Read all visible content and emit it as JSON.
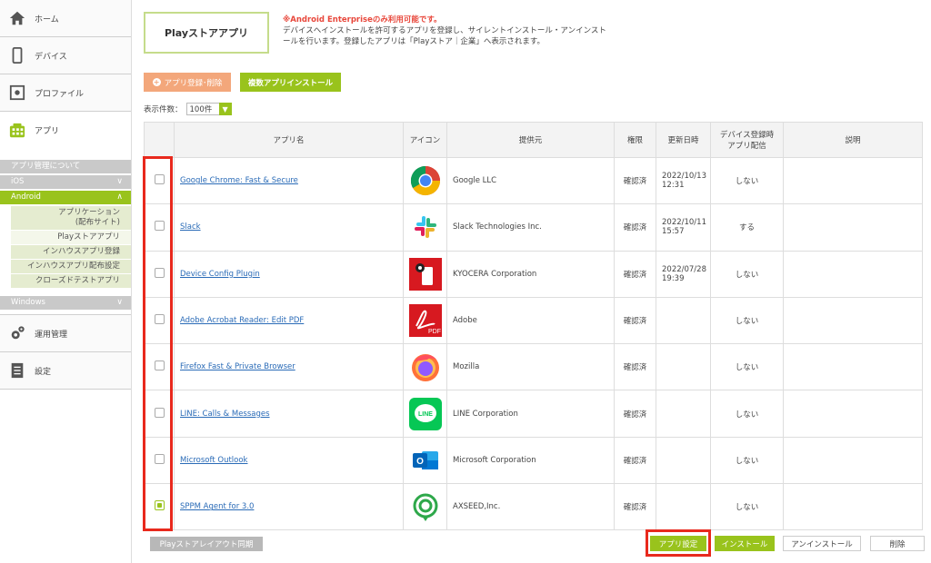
{
  "sidebar": {
    "home": "ホーム",
    "devices": "デバイス",
    "profile": "プロファイル",
    "apps": "アプリ",
    "about_apps": "アプリ管理について",
    "ios": "iOS",
    "android": "Android",
    "android_sub": [
      "アプリケーション\n(配布サイト)",
      "Playストアアプリ",
      "インハウスアプリ登録",
      "インハウスアプリ配布設定",
      "クローズドテストアプリ"
    ],
    "windows": "Windows",
    "operations": "運用管理",
    "settings": "設定"
  },
  "main": {
    "title": "Playストアアプリ",
    "notice_red": "※Android Enterpriseのみ利用可能です。",
    "notice_line1": "デバイスへインストールを許可するアプリを登録し、サイレントインストール・アンインスト",
    "notice_line2": "ールを行います。登録したアプリは「Playストア｜企業」へ表示されます。",
    "register_button": "アプリ登録･削除",
    "multi_install_button": "複数アプリインストール",
    "count_label": "表示件数：",
    "count_value": "100件"
  },
  "table": {
    "headers": {
      "name": "アプリ名",
      "icon": "アイコン",
      "provider": "提供元",
      "permission": "権限",
      "updated": "更新日時",
      "dist1": "デバイス登録時",
      "dist2": "アプリ配信",
      "desc": "説明"
    },
    "rows": [
      {
        "name": "Google Chrome: Fast & Secure",
        "provider": "Google LLC",
        "perm": "確認済",
        "date": "2022/10/13",
        "time": "12:31",
        "dist": "しない",
        "checked": false
      },
      {
        "name": "Slack",
        "provider": "Slack Technologies Inc.",
        "perm": "確認済",
        "date": "2022/10/11",
        "time": "15:57",
        "dist": "する",
        "checked": false
      },
      {
        "name": "Device Config Plugin",
        "provider": "KYOCERA Corporation",
        "perm": "確認済",
        "date": "2022/07/28",
        "time": "19:39",
        "dist": "しない",
        "checked": false
      },
      {
        "name": "Adobe Acrobat Reader: Edit PDF",
        "provider": "Adobe",
        "perm": "確認済",
        "date": "",
        "time": "",
        "dist": "しない",
        "checked": false
      },
      {
        "name": "Firefox Fast & Private Browser",
        "provider": "Mozilla",
        "perm": "確認済",
        "date": "",
        "time": "",
        "dist": "しない",
        "checked": false
      },
      {
        "name": "LINE: Calls & Messages",
        "provider": "LINE Corporation",
        "perm": "確認済",
        "date": "",
        "time": "",
        "dist": "しない",
        "checked": false
      },
      {
        "name": "Microsoft Outlook",
        "provider": "Microsoft Corporation",
        "perm": "確認済",
        "date": "",
        "time": "",
        "dist": "しない",
        "checked": false
      },
      {
        "name": "SPPM Agent for 3.0",
        "provider": "AXSEED,Inc.",
        "perm": "確認済",
        "date": "",
        "time": "",
        "dist": "しない",
        "checked": true
      }
    ],
    "icon_text": {
      "pdf": "PDF",
      "line": "LINE",
      "outlook": "O"
    }
  },
  "footer": {
    "sync_button": "Playストアレイアウト同期",
    "app_setting_button": "アプリ設定",
    "install_button": "インストール",
    "uninstall_button": "アンインストール",
    "delete_button": "削除"
  },
  "colors": {
    "accent": "#99c31c",
    "orange": "#f3a77b",
    "highlight": "#e8291d",
    "link": "#2a6bb7"
  }
}
